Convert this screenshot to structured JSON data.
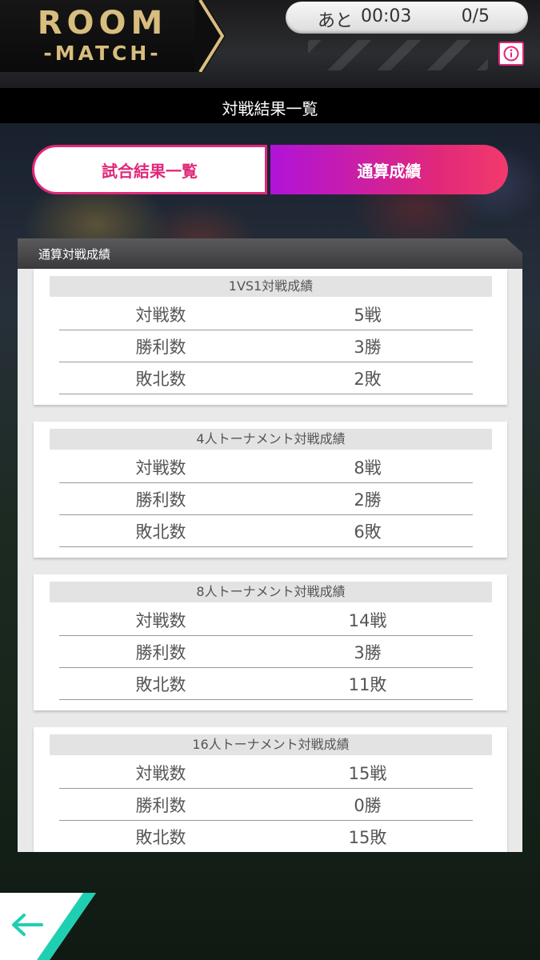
{
  "header": {
    "brand_title": "ROOM",
    "brand_subtitle": "-MATCH-",
    "timer_label": "あと",
    "timer_value": "00:03",
    "match_count": "0/5",
    "info_icon": "info-icon"
  },
  "page": {
    "title": "対戦結果一覧"
  },
  "tabs": [
    {
      "label": "試合結果一覧",
      "active": false
    },
    {
      "label": "通算成績",
      "active": true
    }
  ],
  "stats": {
    "section_title": "通算対戦成績",
    "groups": [
      {
        "title": "1VS1対戦成績",
        "rows": [
          {
            "label": "対戦数",
            "value": "5戦"
          },
          {
            "label": "勝利数",
            "value": "3勝"
          },
          {
            "label": "敗北数",
            "value": "2敗"
          }
        ]
      },
      {
        "title": "4人トーナメント対戦成績",
        "rows": [
          {
            "label": "対戦数",
            "value": "8戦"
          },
          {
            "label": "勝利数",
            "value": "2勝"
          },
          {
            "label": "敗北数",
            "value": "6敗"
          }
        ]
      },
      {
        "title": "8人トーナメント対戦成績",
        "rows": [
          {
            "label": "対戦数",
            "value": "14戦"
          },
          {
            "label": "勝利数",
            "value": "3勝"
          },
          {
            "label": "敗北数",
            "value": "11敗"
          }
        ]
      },
      {
        "title": "16人トーナメント対戦成績",
        "rows": [
          {
            "label": "対戦数",
            "value": "15戦"
          },
          {
            "label": "勝利数",
            "value": "0勝"
          },
          {
            "label": "敗北数",
            "value": "15敗"
          }
        ]
      }
    ]
  },
  "footer": {
    "back_icon": "back-arrow-icon"
  },
  "colors": {
    "accent_pink": "#e0287a",
    "accent_purple": "#b013d8",
    "brand_gold": "#d8bd7e",
    "back_teal": "#1fcfb2"
  }
}
